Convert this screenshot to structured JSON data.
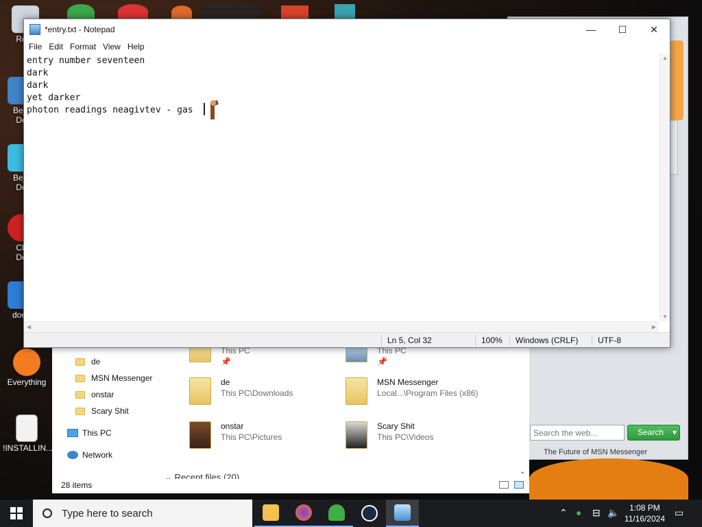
{
  "desktop": {
    "icons": [
      {
        "label": "Recy",
        "color": "#cfd6dd"
      },
      {
        "label": "Beje\nDe",
        "color": "#3f83c8"
      },
      {
        "label": "Beje\nDe",
        "color": "#3bbbe0"
      },
      {
        "label": "Ch\nDe",
        "color": "#c22"
      },
      {
        "label": "does",
        "color": "#2f7dd6"
      },
      {
        "label": "Everything",
        "color": "#f47b20"
      },
      {
        "label": "!INSTALLIN...",
        "color": "#f2f2f2"
      }
    ]
  },
  "notepad": {
    "title": "*entry.txt - Notepad",
    "menu": [
      "File",
      "Edit",
      "Format",
      "View",
      "Help"
    ],
    "text": "entry number seventeen\ndark\ndark\nyet darker\nphoton readings neagivtev - gas",
    "status": {
      "position": "Ln 5, Col 32",
      "zoom": "100%",
      "eol": "Windows (CRLF)",
      "encoding": "UTF-8"
    },
    "controls": {
      "minimize": "—",
      "maximize": "☐",
      "close": "✕"
    }
  },
  "explorer": {
    "nav": [
      {
        "label": "de",
        "type": "folder"
      },
      {
        "label": "MSN Messenger",
        "type": "folder"
      },
      {
        "label": "onstar",
        "type": "folder"
      },
      {
        "label": "Scary Shit",
        "type": "folder"
      },
      {
        "label": "This PC",
        "type": "pc"
      },
      {
        "label": "Network",
        "type": "network"
      }
    ],
    "tiles": [
      {
        "name": "",
        "path": "This PC"
      },
      {
        "name": "",
        "path": "This PC"
      },
      {
        "name": "de",
        "path": "This PC\\Downloads"
      },
      {
        "name": "MSN Messenger",
        "path": "Local...\\Program Files (x86)"
      },
      {
        "name": "onstar",
        "path": "This PC\\Pictures"
      },
      {
        "name": "Scary Shit",
        "path": "This PC\\Videos"
      }
    ],
    "recent": "Recent files (20)",
    "status": "28 items"
  },
  "msn": {
    "search_placeholder": "Search the web...",
    "search_button": "Search",
    "footer": "The Future of MSN Messenger"
  },
  "taskbar": {
    "search_placeholder": "Type here to search",
    "time": "1:08 PM",
    "date": "11/16/2024"
  }
}
